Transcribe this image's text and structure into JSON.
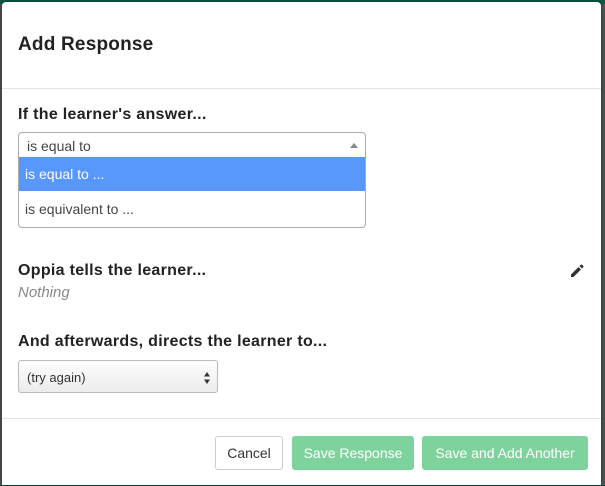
{
  "modal": {
    "title": "Add Response"
  },
  "rule": {
    "label": "If the learner's answer...",
    "selected": "is equal to",
    "options": [
      {
        "label": "is equal to ..."
      },
      {
        "label": "is equivalent to ..."
      }
    ]
  },
  "feedback": {
    "label": "Oppia tells the learner...",
    "value": "Nothing"
  },
  "destination": {
    "label": "And afterwards, directs the learner to...",
    "selected": "(try again)"
  },
  "footer": {
    "cancel_label": "Cancel",
    "save_label": "Save Response",
    "save_add_label": "Save and Add Another"
  },
  "colors": {
    "highlight": "#5897fb",
    "primary_button_disabled": "#7ed39c"
  },
  "icons": {
    "edit": "pencil-icon",
    "dropdown_open": "caret-up-icon",
    "select_arrows": "up-down-arrows-icon"
  }
}
